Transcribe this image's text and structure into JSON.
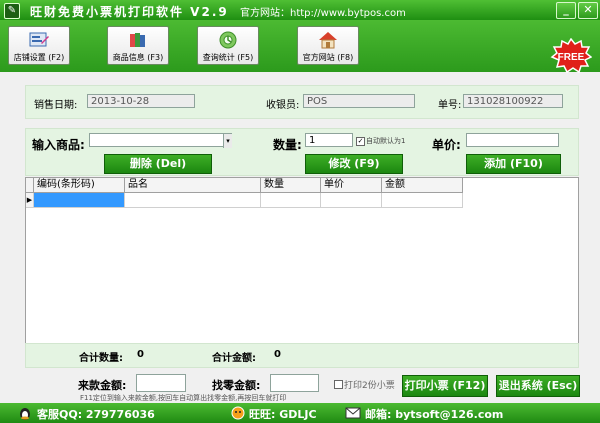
{
  "window": {
    "title": "旺财免费小票机打印软件 V2.9",
    "site_text": "官方网站：http://www.bytpos.com",
    "minimize_glyph": "_",
    "close_glyph": "✕"
  },
  "toolbar": {
    "buttons": [
      {
        "label": "店铺设置 (F2)",
        "icon": "shop-settings-icon"
      },
      {
        "label": "商品信息 (F3)",
        "icon": "goods-info-icon"
      },
      {
        "label": "查询统计 (F5)",
        "icon": "query-stats-icon"
      },
      {
        "label": "官方网站 (F8)",
        "icon": "home-icon"
      }
    ],
    "badge": "FREE"
  },
  "sale_info": {
    "date_label": "销售日期:",
    "date_value": "2013-10-28",
    "cashier_label": "收银员:",
    "cashier_value": "POS",
    "order_label": "单号:",
    "order_value": "131028100922"
  },
  "entry": {
    "product_label": "输入商品:",
    "product_value": "",
    "qty_label": "数量:",
    "qty_value": "1",
    "auto_default_label": "自动默认为1",
    "auto_default_checked": true,
    "price_label": "单价:",
    "price_value": "",
    "delete_button": "删除 (Del)",
    "modify_button": "修改 (F9)",
    "add_button": "添加 (F10)"
  },
  "grid": {
    "columns": [
      "编码(条形码)",
      "品名",
      "数量",
      "单价",
      "金额"
    ],
    "row_marker": "▶"
  },
  "totals": {
    "qty_label": "合计数量:",
    "qty_value": "0",
    "amount_label": "合计金额:",
    "amount_value": "0"
  },
  "payment": {
    "received_label": "来款金额:",
    "received_value": "",
    "change_label": "找零金额:",
    "change_value": "",
    "print_two_label": "打印2份小票",
    "print_two_checked": false,
    "print_button": "打印小票 (F12)",
    "exit_button": "退出系统 (Esc)",
    "hint": "F11定位到输入来款金额,按回车自动算出找零金额,再按回车就打印"
  },
  "status": {
    "qq": "客服QQ: 279776036",
    "wangwang": "旺旺: GDLJC",
    "email": "邮箱: bytsoft@126.com"
  },
  "colors": {
    "brand_green": "#2c9a1c",
    "panel_green": "#e4f4e2",
    "badge_red": "#e0201a"
  }
}
